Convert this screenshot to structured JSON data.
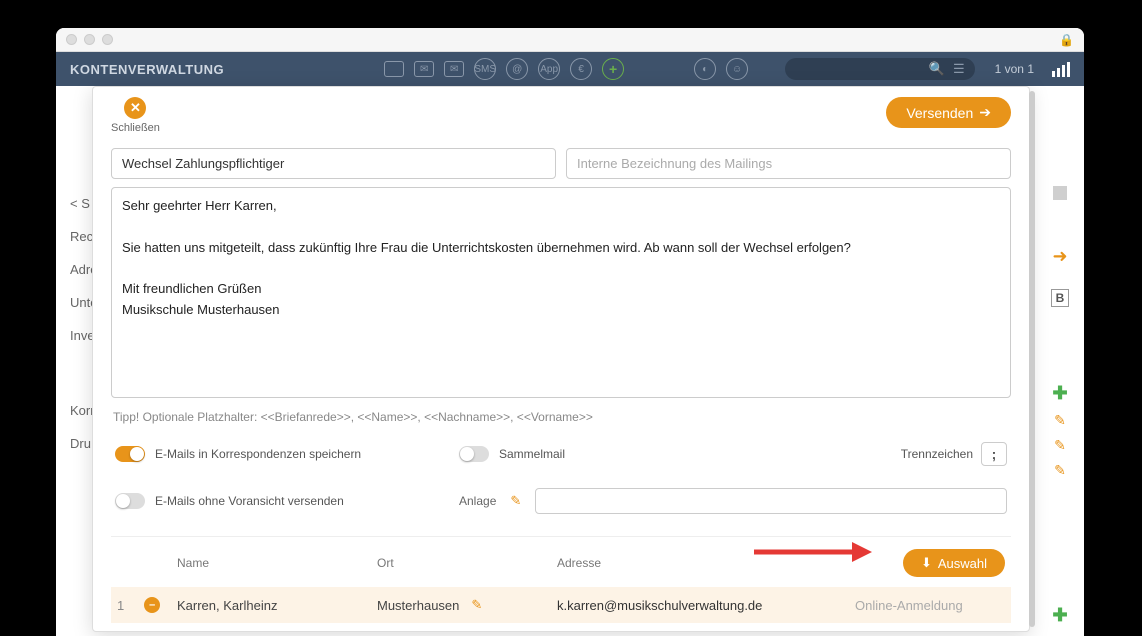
{
  "toolbar": {
    "title": "KONTENVERWALTUNG",
    "page_count": "1 von 1"
  },
  "bg": {
    "left_items": [
      "< S",
      "Recl",
      "Adre",
      "Unte",
      "Inve",
      "Korr",
      "Dru"
    ],
    "right_b": "B"
  },
  "modal": {
    "close_label": "Schließen",
    "send_label": "Versenden",
    "subject": "Wechsel Zahlungspflichtiger",
    "internal_placeholder": "Interne Bezeichnung des Mailings",
    "message": "Sehr geehrter Herr Karren,\n\nSie hatten uns mitgeteilt, dass zukünftig Ihre Frau die Unterrichtskosten übernehmen wird. Ab wann soll der Wechsel erfolgen?\n\nMit freundlichen Grüßen\nMusikschule Musterhausen",
    "tip": "Tipp! Optionale Platzhalter: <<Briefanrede>>, <<Name>>, <<Nachname>>, <<Vorname>>",
    "opt_save": "E-Mails in Korrespondenzen speichern",
    "opt_sammel": "Sammelmail",
    "opt_trenn_label": "Trennzeichen",
    "opt_trenn_value": ";",
    "opt_nopreview": "E-Mails ohne Voransicht versenden",
    "opt_anlage": "Anlage",
    "table": {
      "col_name": "Name",
      "col_ort": "Ort",
      "col_addr": "Adresse",
      "auswahl_label": "Auswahl",
      "rows": [
        {
          "idx": "1",
          "name": "Karren, Karlheinz",
          "ort": "Musterhausen",
          "addr": "k.karren@musikschulverwaltung.de",
          "source": "Online-Anmeldung"
        }
      ]
    }
  }
}
